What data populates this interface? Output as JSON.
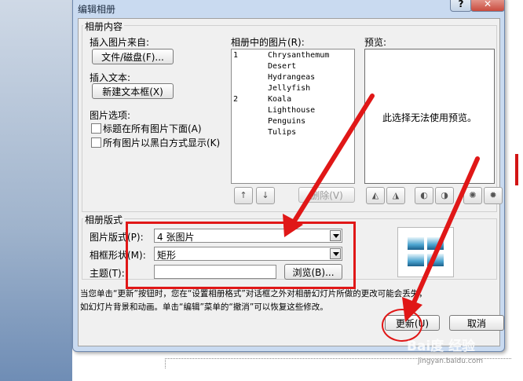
{
  "dialog": {
    "title": "编辑相册",
    "help_label": "?",
    "close_label": "✕"
  },
  "album_content": {
    "group_label": "相册内容",
    "insert_picture_from_label": "插入图片来自:",
    "file_disk_button": "文件/磁盘(F)...",
    "insert_text_label": "插入文本:",
    "new_textbox_button": "新建文本框(X)",
    "picture_options_label": "图片选项:",
    "caption_below_label": "标题在所有图片下面(A)",
    "black_white_label": "所有图片以黑白方式显示(K)"
  },
  "pictures_list": {
    "label": "相册中的图片(R):",
    "items": [
      {
        "num": "1",
        "name": "Chrysanthemum"
      },
      {
        "num": "",
        "name": "Desert"
      },
      {
        "num": "",
        "name": "Hydrangeas"
      },
      {
        "num": "",
        "name": "Jellyfish"
      },
      {
        "num": "2",
        "name": "Koala"
      },
      {
        "num": "",
        "name": "Lighthouse"
      },
      {
        "num": "",
        "name": "Penguins"
      },
      {
        "num": "",
        "name": "Tulips"
      }
    ],
    "move_up_glyph": "↑",
    "move_down_glyph": "↓",
    "delete_button": "删除(V)"
  },
  "preview": {
    "label": "预览:",
    "message": "此选择无法使用预览。"
  },
  "layout": {
    "group_label": "相册版式",
    "picture_layout_label": "图片版式(P):",
    "picture_layout_value": "4 张图片",
    "frame_shape_label": "相框形状(M):",
    "frame_shape_value": "矩形",
    "theme_label": "主题(T):",
    "theme_value": "",
    "browse_button": "浏览(B)..."
  },
  "footer": {
    "note_line1": "当您单击“更新”按钮时，您在“设置相册格式”对话框之外对相册幻灯片所做的更改可能会丢失，",
    "note_line2": "如幻灯片背景和动画。单击“编辑”菜单的“撤消”可以恢复这些修改。",
    "update_button": "更新(U)",
    "cancel_button": "取消"
  },
  "watermark": {
    "brand": "Bai度 经验",
    "url": "jingyan.baidu.com"
  },
  "colors": {
    "annotation_red": "#e01717",
    "dialog_frame": "#c9daf0"
  }
}
